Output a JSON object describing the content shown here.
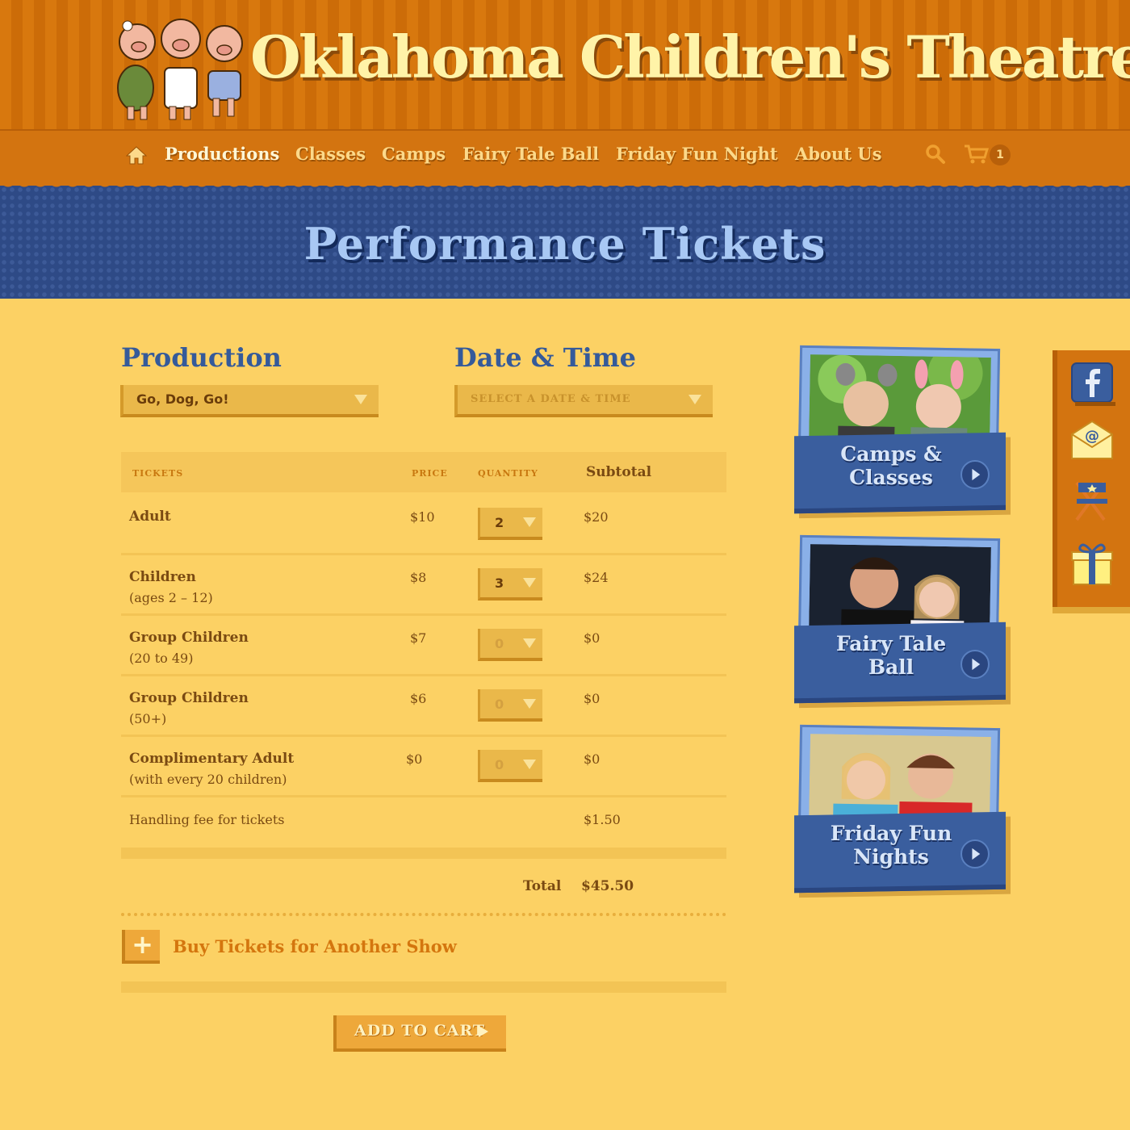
{
  "header": {
    "logo_text": "Oklahoma Children's Theatre"
  },
  "nav": {
    "items": [
      {
        "label": "Productions",
        "active": true
      },
      {
        "label": "Classes",
        "active": false
      },
      {
        "label": "Camps",
        "active": false
      },
      {
        "label": "Fairy Tale Ball",
        "active": false
      },
      {
        "label": "Friday Fun Night",
        "active": false
      },
      {
        "label": "About Us",
        "active": false
      }
    ],
    "home_icon": "home-icon",
    "search_icon": "search-icon",
    "cart_icon": "cart-icon",
    "cart_count": "1"
  },
  "page": {
    "title": "Performance Tickets"
  },
  "form": {
    "production_label": "Production",
    "production_value": "Go, Dog, Go!",
    "datetime_label": "Date & Time",
    "datetime_placeholder": "SELECT A DATE & TIME"
  },
  "table": {
    "headers": {
      "tickets": "TICKETS",
      "price": "PRICE",
      "quantity": "QUANTITY",
      "subtotal": "Subtotal"
    },
    "rows": [
      {
        "name": "Adult",
        "note": "",
        "price": "$10",
        "qty": "2",
        "subtotal": "$20"
      },
      {
        "name": "Children",
        "note": "(ages 2 – 12)",
        "price": "$8",
        "qty": "3",
        "subtotal": "$24"
      },
      {
        "name": "Group Children",
        "note": "(20 to 49)",
        "price": "$7",
        "qty": "0",
        "subtotal": "$0"
      },
      {
        "name": "Group Children",
        "note": "(50+)",
        "price": "$6",
        "qty": "0",
        "subtotal": "$0"
      },
      {
        "name": "Complimentary Adult",
        "note": "(with every 20 children)",
        "price": "$0",
        "qty": "0",
        "subtotal": "$0"
      }
    ],
    "handling_label": "Handling fee for tickets",
    "handling_value": "$1.50",
    "total_label": "Total",
    "total_value": "$45.50"
  },
  "actions": {
    "buy_another_label": "Buy Tickets for Another Show",
    "add_to_cart_label": "ADD TO CART"
  },
  "sidebar": {
    "cards": [
      {
        "label_line1": "Camps &",
        "label_line2": "Classes"
      },
      {
        "label_line1": "Fairy Tale",
        "label_line2": "Ball"
      },
      {
        "label_line1": "Friday Fun",
        "label_line2": "Nights"
      }
    ]
  },
  "social": {
    "icons": [
      "facebook-icon",
      "email-icon",
      "directors-chair-icon",
      "gift-icon"
    ]
  },
  "colors": {
    "page_bg": "#fcd164",
    "header_orange": "#d37410",
    "navy": "#2e4a86",
    "card_blue": "#3a5e9e",
    "text_brown": "#7a4a12"
  }
}
